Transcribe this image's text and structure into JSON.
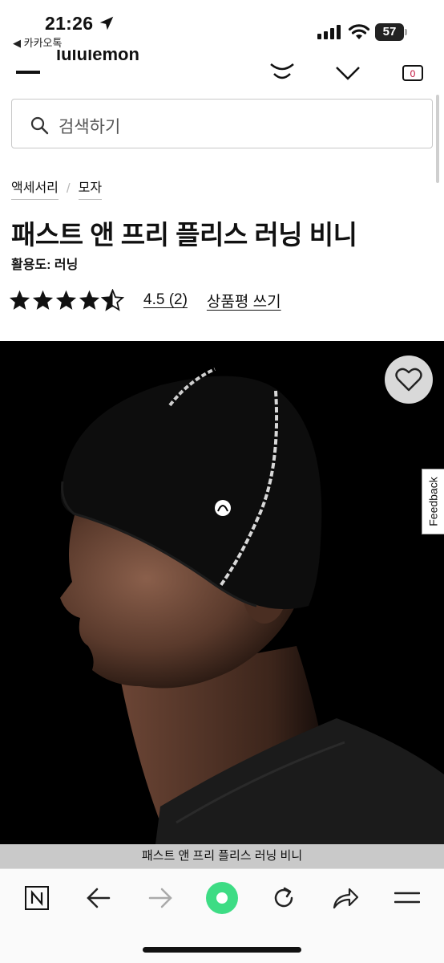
{
  "status_bar": {
    "time": "21:26",
    "back_app": "◀ 카카오톡",
    "battery": "57"
  },
  "header": {
    "logo": "lululemon",
    "cart_count": "0"
  },
  "search": {
    "placeholder": "검색하기"
  },
  "breadcrumb": [
    "액세서리",
    "모자"
  ],
  "product": {
    "title": "패스트 앤 프리 플리스 러닝 비니",
    "activity": "활용도: 러닝",
    "rating_value": 4.5,
    "rating_text": "4.5 (2)",
    "write_review": "상품평 쓰기",
    "image_caption": "패스트 앤 프리 플리스 러닝 비니"
  },
  "feedback_label": "Feedback",
  "colors": {
    "text": "#111111",
    "image_bg": "#000000",
    "wish_btn_bg": "#d9d9d9",
    "caption_bg": "#c9c9c9",
    "home_button": "#3ddc84"
  },
  "toolbar": {
    "icons": [
      "naver-n-icon",
      "back-arrow-icon",
      "forward-arrow-icon",
      "home-green-icon",
      "reload-icon",
      "share-icon",
      "menu-icon"
    ]
  }
}
